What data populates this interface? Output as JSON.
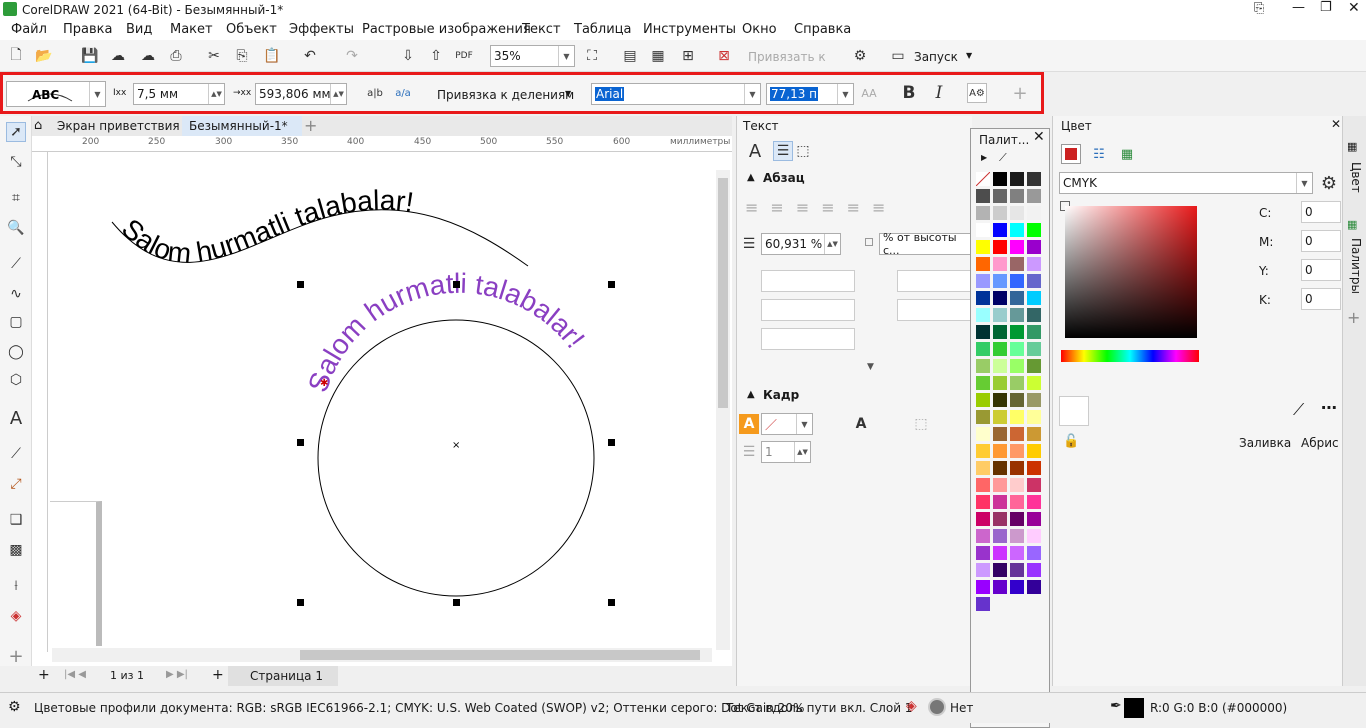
{
  "title": "CorelDRAW 2021 (64-Bit) - Безымянный-1*",
  "menu": [
    "Файл",
    "Правка",
    "Вид",
    "Макет",
    "Объект",
    "Эффекты",
    "Растровые изображения",
    "Текст",
    "Таблица",
    "Инструменты",
    "Окно",
    "Справка"
  ],
  "std": {
    "zoom": "35%",
    "snap": "Привязать к",
    "launch": "Запуск"
  },
  "prop": {
    "offset_x": "7,5 мм",
    "offset_y": "593,806 мм",
    "snap": "Привязка к делениям",
    "font": "Arial",
    "size": "77,13 п"
  },
  "tabs": {
    "welcome": "Экран приветствия",
    "doc": "Безымянный-1*"
  },
  "ruler": {
    "top": [
      "200",
      "250",
      "300",
      "350",
      "400",
      "450",
      "500",
      "550",
      "600",
      "650"
    ],
    "unit": "миллиметры",
    "left": [
      "550",
      "500",
      "450",
      "400",
      "350",
      "300",
      "250"
    ]
  },
  "canvas": {
    "text1": "Salom hurmatli talabalar!",
    "text2": "Salom hurmatli talabalar!"
  },
  "text_docker": {
    "title": "Текст",
    "para": "Абзац",
    "spacing": "60,931 %",
    "spacing_unit": "% от высоты с...",
    "frame": "Кадр",
    "cols": "1"
  },
  "palette": {
    "title": "Палит..."
  },
  "color_docker": {
    "title": "Цвет",
    "model": "CMYK",
    "c_label": "C:",
    "m_label": "M:",
    "y_label": "Y:",
    "k_label": "K:",
    "c": "0",
    "m": "0",
    "y": "0",
    "k": "0",
    "fill": "Заливка",
    "outline": "Абрис"
  },
  "rtabs": {
    "color": "Цвет",
    "palettes": "Палитры"
  },
  "pagebar": {
    "count": "1  из  1",
    "page": "Страница 1"
  },
  "status": {
    "profiles": "Цветовые профили документа: RGB: sRGB IEC61966-2.1; CMYK: U.S. Web Coated (SWOP) v2; Оттенки серого: Dot Gain 20%",
    "obj": "Текст вдоль пути вкл. Слой 1",
    "fill": "Нет",
    "outline": "R:0 G:0 B:0 (#000000)"
  },
  "swatches": [
    "#000000",
    "#1a1a1a",
    "#333333",
    "#4d4d4d",
    "#666666",
    "#808080",
    "#999999",
    "#b3b3b3",
    "#cccccc",
    "#e6e6e6",
    "#f2f2f2",
    "#ffffff",
    "#0000ff",
    "#00ffff",
    "#00ff00",
    "#ffff00",
    "#ff0000",
    "#ff00ff",
    "#9900cc",
    "#ff6600",
    "#ff99cc",
    "#996666",
    "#cc99ff",
    "#9999ff",
    "#6699ff",
    "#3366ff",
    "#6666cc",
    "#003399",
    "#000066",
    "#336699",
    "#00ccff",
    "#99ffff",
    "#99cccc",
    "#669999",
    "#336666",
    "#003333",
    "#006633",
    "#009933",
    "#339966",
    "#33cc66",
    "#33cc33",
    "#66ff99",
    "#66cc99",
    "#99cc66",
    "#ccff99",
    "#99ff66",
    "#669933",
    "#66cc33",
    "#99cc33",
    "#99cc66",
    "#ccff33",
    "#99cc00",
    "#333300",
    "#666633",
    "#999966",
    "#999933",
    "#cccc33",
    "#ffff66",
    "#ffff99",
    "#ffffcc",
    "#996633",
    "#cc6633",
    "#cc9933",
    "#ffcc33",
    "#ff9933",
    "#ff9966",
    "#ffcc00",
    "#ffcc66",
    "#663300",
    "#993300",
    "#cc3300",
    "#ff6666",
    "#ff9999",
    "#ffcccc",
    "#cc3366",
    "#ff3366",
    "#cc3399",
    "#ff6699",
    "#ff3399",
    "#cc0066",
    "#993366",
    "#660066",
    "#990099",
    "#cc66cc",
    "#9966cc",
    "#cc99cc",
    "#ffccff",
    "#9933cc",
    "#cc33ff",
    "#cc66ff",
    "#9966ff",
    "#cc99ff",
    "#330066",
    "#663399",
    "#9933ff",
    "#9900ff",
    "#6600cc",
    "#3300cc",
    "#330099",
    "#6633cc"
  ]
}
